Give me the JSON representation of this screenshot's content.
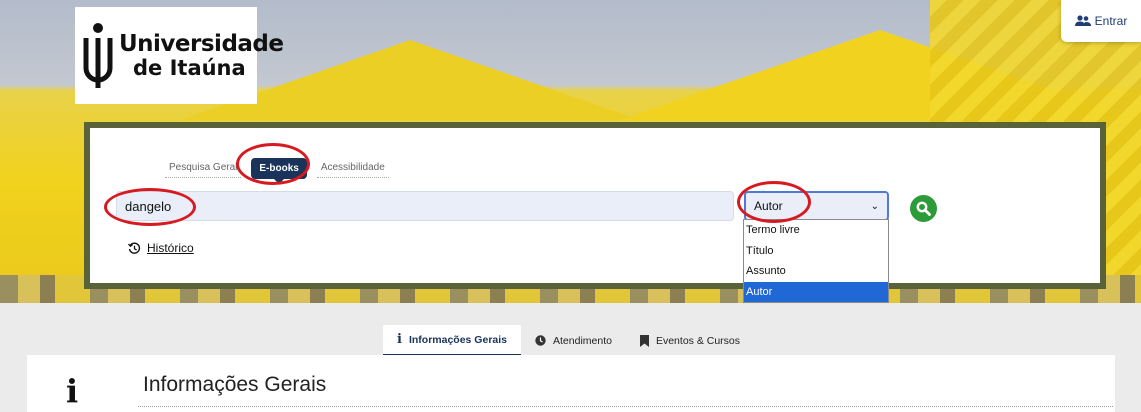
{
  "brand": {
    "line1": "Universidade",
    "line2": "de Itaúna"
  },
  "header": {
    "login_label": "Entrar",
    "login_icon": "users-icon"
  },
  "search": {
    "tabs": [
      {
        "label": "Pesquisa Geral",
        "active": false
      },
      {
        "label": "E-books",
        "active": true
      },
      {
        "label": "Acessibilidade",
        "active": false
      }
    ],
    "query": "dangelo",
    "field_selected": "Autor",
    "field_options": [
      "Termo livre",
      "Título",
      "Assunto",
      "Autor"
    ],
    "search_icon": "search-icon",
    "history_label": "Histórico"
  },
  "info_tabs": [
    {
      "label": "Informações Gerais",
      "icon": "info-icon",
      "active": true
    },
    {
      "label": "Atendimento",
      "icon": "clock-icon",
      "active": false
    },
    {
      "label": "Eventos & Cursos",
      "icon": "bookmark-icon",
      "active": false
    }
  ],
  "section": {
    "icon_glyph": "i",
    "title": "Informações Gerais"
  },
  "colors": {
    "navy": "#19335a",
    "search_green": "#2e9b3a",
    "annotation_red": "#d71920",
    "panel_border": "#5a623a"
  }
}
